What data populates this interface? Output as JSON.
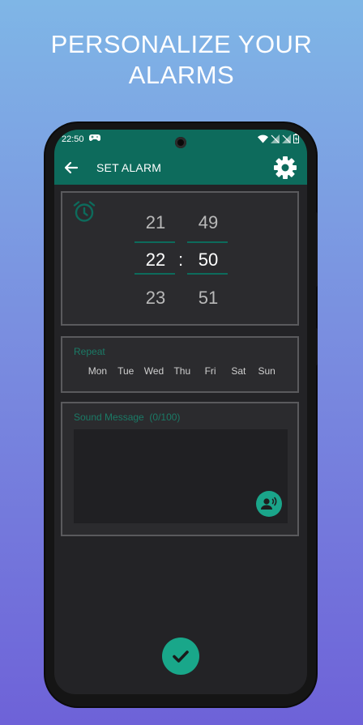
{
  "promo": {
    "headline_line1": "PERSONALIZE YOUR",
    "headline_line2": "ALARMS"
  },
  "status_bar": {
    "time": "22:50",
    "icons": [
      "gamepad-icon",
      "wifi-icon",
      "signal-icon",
      "signal-icon",
      "battery-icon"
    ]
  },
  "app_bar": {
    "title": "SET ALARM",
    "back_icon": "arrow-left-icon",
    "settings_icon": "gear-icon"
  },
  "time_picker": {
    "hours": [
      "21",
      "22",
      "23"
    ],
    "minutes": [
      "49",
      "50",
      "51"
    ],
    "selected_hour": "22",
    "selected_minute": "50",
    "separator": ":",
    "icon": "alarm-clock-icon"
  },
  "repeat": {
    "label": "Repeat",
    "days": [
      "Mon",
      "Tue",
      "Wed",
      "Thu",
      "Fri",
      "Sat",
      "Sun"
    ]
  },
  "sound_message": {
    "label": "Sound Message  (0/100)",
    "value": "",
    "voice_icon": "record-voice-icon"
  },
  "confirm": {
    "icon": "checkmark-icon"
  },
  "colors": {
    "accent": "#0d6b5c",
    "button": "#19a78a",
    "screen_bg": "#232326",
    "card_bg": "#2b2b2e"
  }
}
